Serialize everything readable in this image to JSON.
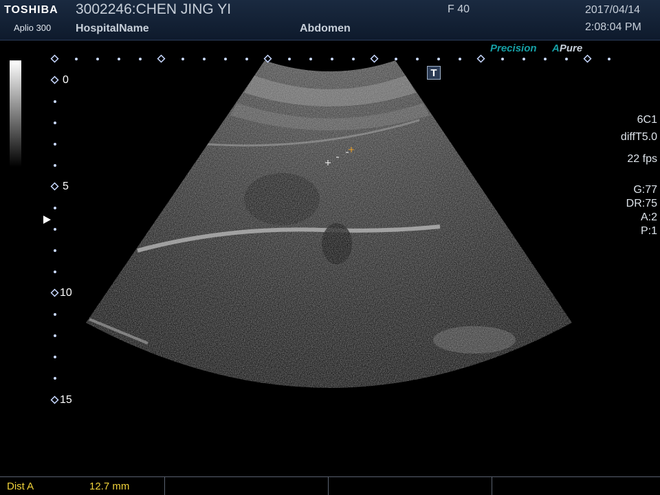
{
  "header": {
    "brand": "TOSHIBA",
    "model": "Aplio 300",
    "patient": "3002246:CHEN JING YI",
    "hospital": "HospitalName",
    "sex_age": "F  40",
    "exam": "Abdomen",
    "date": "2017/04/14",
    "time": "2:08:04 PM"
  },
  "depth_scale": {
    "labels": [
      "0",
      "5",
      "10",
      "15"
    ]
  },
  "mode_labels": {
    "precision": "Precision",
    "apure_a": "A",
    "apure_rest": "Pure",
    "t_button": "T"
  },
  "params": {
    "probe": "6C1",
    "mode": "diffT5.0",
    "fps": "22 fps",
    "gain": "G:77",
    "dr": "DR:75",
    "a": "A:2",
    "p": "P:1"
  },
  "measurement": {
    "label": "Dist  A",
    "value": "12.7  mm"
  }
}
